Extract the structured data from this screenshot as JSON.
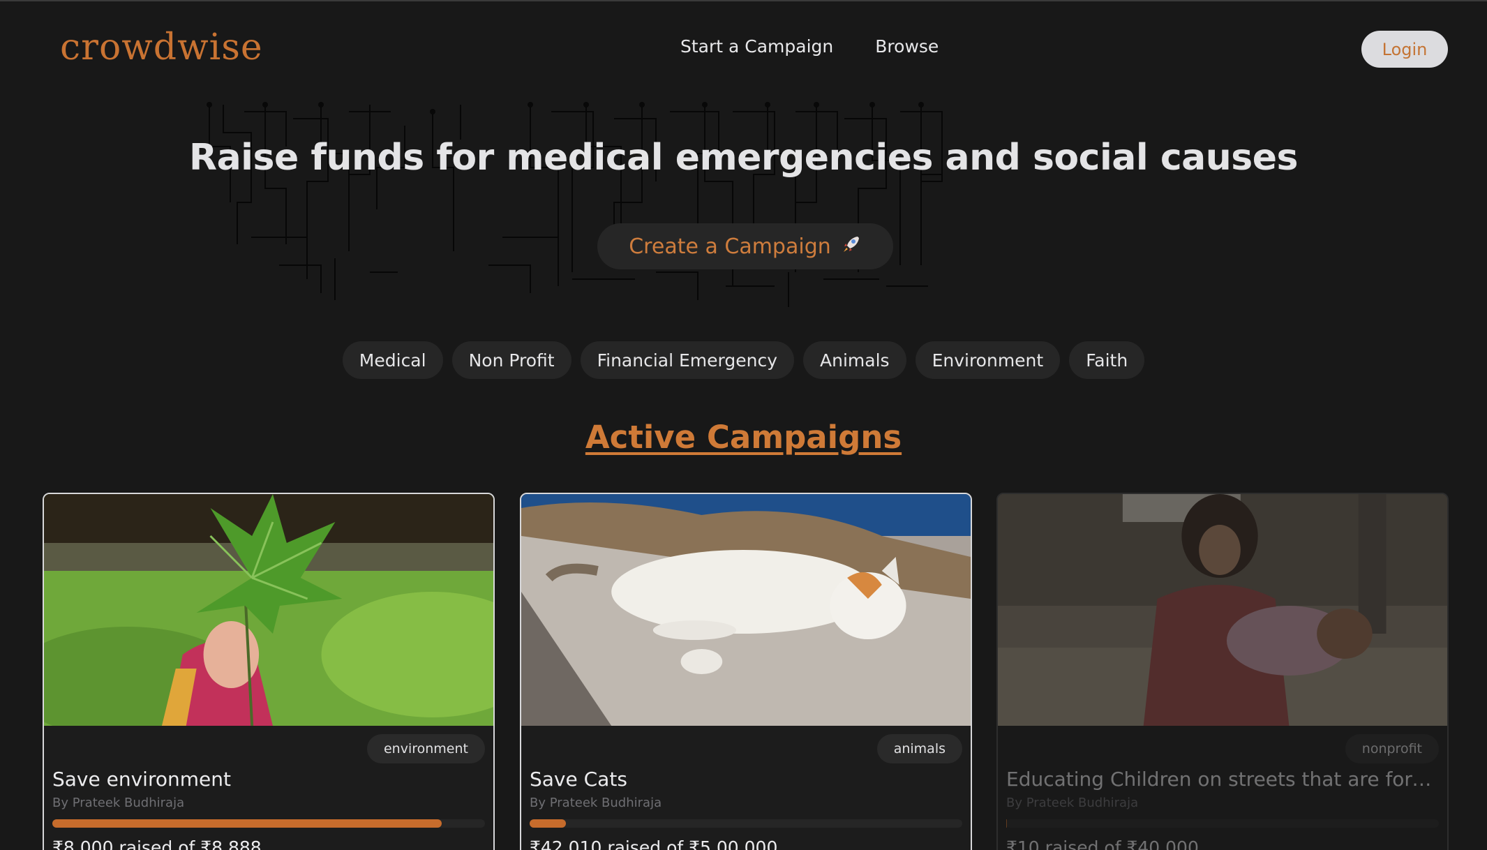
{
  "header": {
    "logo": "crowdwise",
    "nav": [
      "Start a Campaign",
      "Browse"
    ],
    "login_label": "Login"
  },
  "hero": {
    "title": "Raise funds for medical emergencies and social causes",
    "cta_label": "Create a Campaign",
    "cta_icon": "rocket-icon"
  },
  "categories": [
    "Medical",
    "Non Profit",
    "Financial Emergency",
    "Animals",
    "Environment",
    "Faith"
  ],
  "section_title": "Active Campaigns",
  "campaigns": [
    {
      "tag": "environment",
      "title": "Save environment",
      "author": "By Prateek Budhiraja",
      "amount_text": "₹8,000 raised of ₹8,888",
      "progress": 0.9,
      "image": "child holding green leaf"
    },
    {
      "tag": "animals",
      "title": "Save Cats",
      "author": "By Prateek Budhiraja",
      "amount_text": "₹42,010 raised of ₹5,00,000",
      "progress": 0.084,
      "image": "cat sleeping on stone wall"
    },
    {
      "tag": "nonprofit",
      "title": "Educating Children on streets that are forced to beg",
      "author": "By Prateek Budhiraja",
      "amount_text": "₹10 raised of ₹40,000",
      "progress": 0.0003,
      "image": "children on street"
    }
  ],
  "colors": {
    "background": "#181818",
    "accent": "#c97332",
    "card_border": "#d8d8da"
  }
}
